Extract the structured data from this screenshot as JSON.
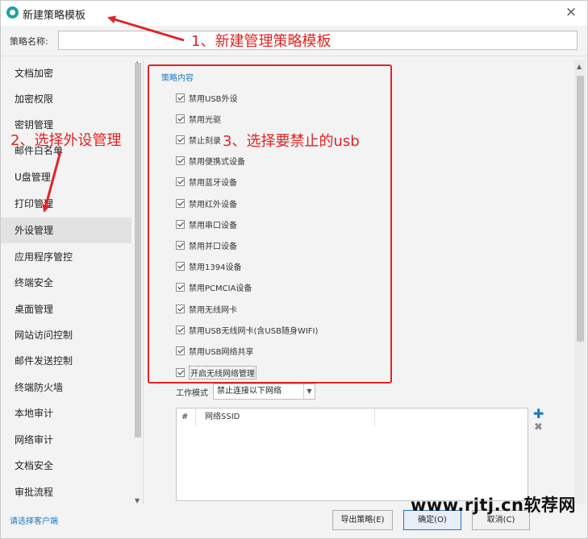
{
  "window": {
    "title": "新建策略模板",
    "close_label": "×"
  },
  "name_row": {
    "label": "策略名称:",
    "value": ""
  },
  "sidebar": {
    "items": [
      {
        "label": "文档加密"
      },
      {
        "label": "加密权限"
      },
      {
        "label": "密钥管理"
      },
      {
        "label": "邮件白名单"
      },
      {
        "label": "U盘管理"
      },
      {
        "label": "打印管理"
      },
      {
        "label": "外设管理",
        "active": true
      },
      {
        "label": "应用程序管控"
      },
      {
        "label": "终端安全"
      },
      {
        "label": "桌面管理"
      },
      {
        "label": "网站访问控制"
      },
      {
        "label": "邮件发送控制"
      },
      {
        "label": "终端防火墙"
      },
      {
        "label": "本地审计"
      },
      {
        "label": "网络审计"
      },
      {
        "label": "文档安全"
      },
      {
        "label": "审批流程"
      }
    ]
  },
  "content": {
    "section_title": "策略内容",
    "checkboxes": [
      {
        "label": "禁用USB外设",
        "checked": true
      },
      {
        "label": "禁用光驱",
        "checked": true
      },
      {
        "label": "禁止刻录",
        "checked": true
      },
      {
        "label": "禁用便携式设备",
        "checked": true
      },
      {
        "label": "禁用蓝牙设备",
        "checked": true
      },
      {
        "label": "禁用红外设备",
        "checked": true
      },
      {
        "label": "禁用串口设备",
        "checked": true
      },
      {
        "label": "禁用并口设备",
        "checked": true
      },
      {
        "label": "禁用1394设备",
        "checked": true
      },
      {
        "label": "禁用PCMCIA设备",
        "checked": true
      },
      {
        "label": "禁用无线网卡",
        "checked": true
      },
      {
        "label": "禁用USB无线网卡(含USB随身WIFI)",
        "checked": true
      },
      {
        "label": "禁用USB网络共享",
        "checked": true
      },
      {
        "label": "开启无线网络管理",
        "checked": true
      }
    ],
    "work_mode": {
      "label": "工作模式",
      "selected": "禁止连接以下网络"
    },
    "network_table": {
      "columns": [
        "#",
        "网络SSID"
      ]
    }
  },
  "footer": {
    "client_link": "请选择客户端",
    "export_label": "导出策略(E)",
    "ok_label": "确定(O)",
    "cancel_label": "取消(C)"
  },
  "annotations": {
    "a1": "1、新建管理策略模板",
    "a2": "2、选择外设管理",
    "a3": "3、选择要禁止的usb",
    "color": "#e02424"
  },
  "watermark": "www.rjtj.cn软荐网"
}
